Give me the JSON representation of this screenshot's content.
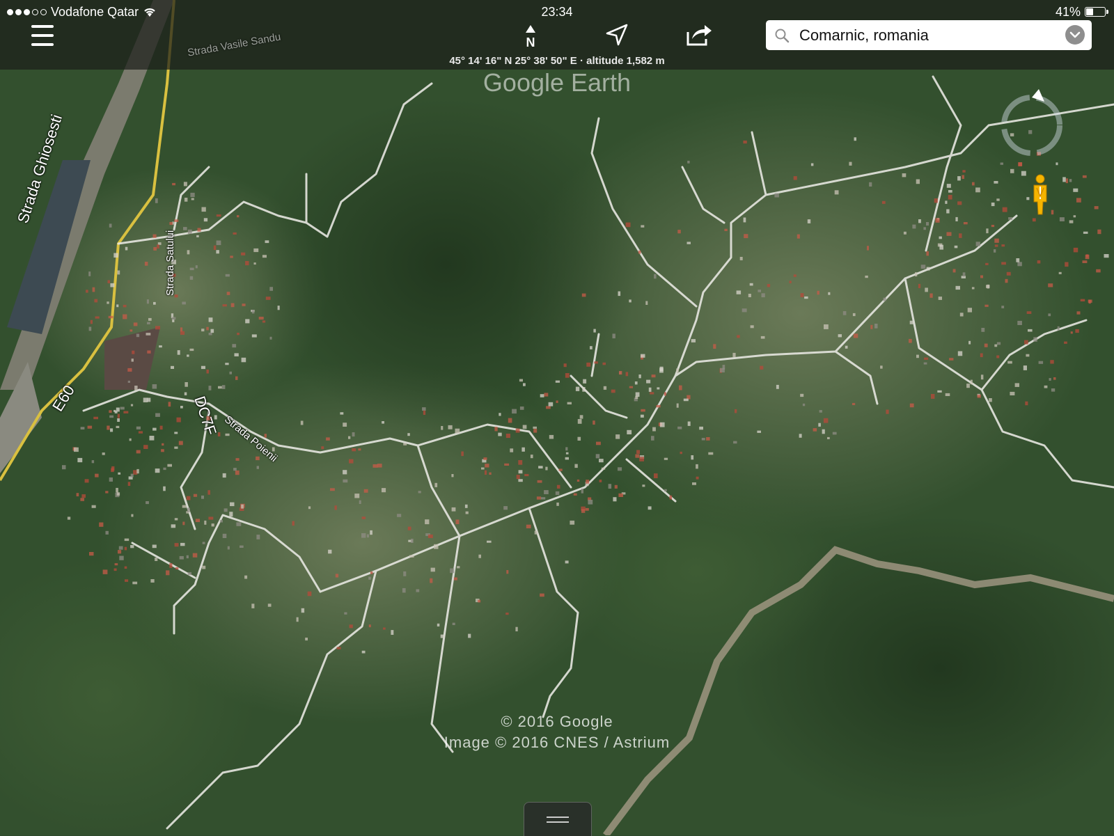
{
  "status_bar": {
    "carrier": "Vodafone Qatar",
    "time": "23:34",
    "battery_percent": "41%",
    "battery_level": 0.41
  },
  "toolbar": {
    "menu_icon": "hamburger-menu-icon",
    "north_label": "N",
    "locate_icon": "location-arrow-icon",
    "share_icon": "share-icon"
  },
  "search": {
    "value": "Comarnic, romania",
    "icon": "search-icon",
    "dropdown_icon": "chevron-down-icon"
  },
  "coordinates": "45° 14' 16\" N  25° 38' 50\" E · altitude 1,582 m",
  "watermark": "Google Earth",
  "map_labels": {
    "strada_ghiosesti": "Strada Ghiosesti",
    "strada_small": "Strada Satului",
    "e60": "E60",
    "dc7f": "DC7F",
    "strada_poienii": "Strada Poienii",
    "strada_top": "Strada Vasile Sandu"
  },
  "copyright": {
    "line1": "© 2016 Google",
    "line2": "Image © 2016 CNES / Astrium"
  },
  "colors": {
    "topbar": "#1c1e1a",
    "forest": "#2f4a2c",
    "road": "#e6e6e0",
    "pegman": "#f5b400"
  }
}
